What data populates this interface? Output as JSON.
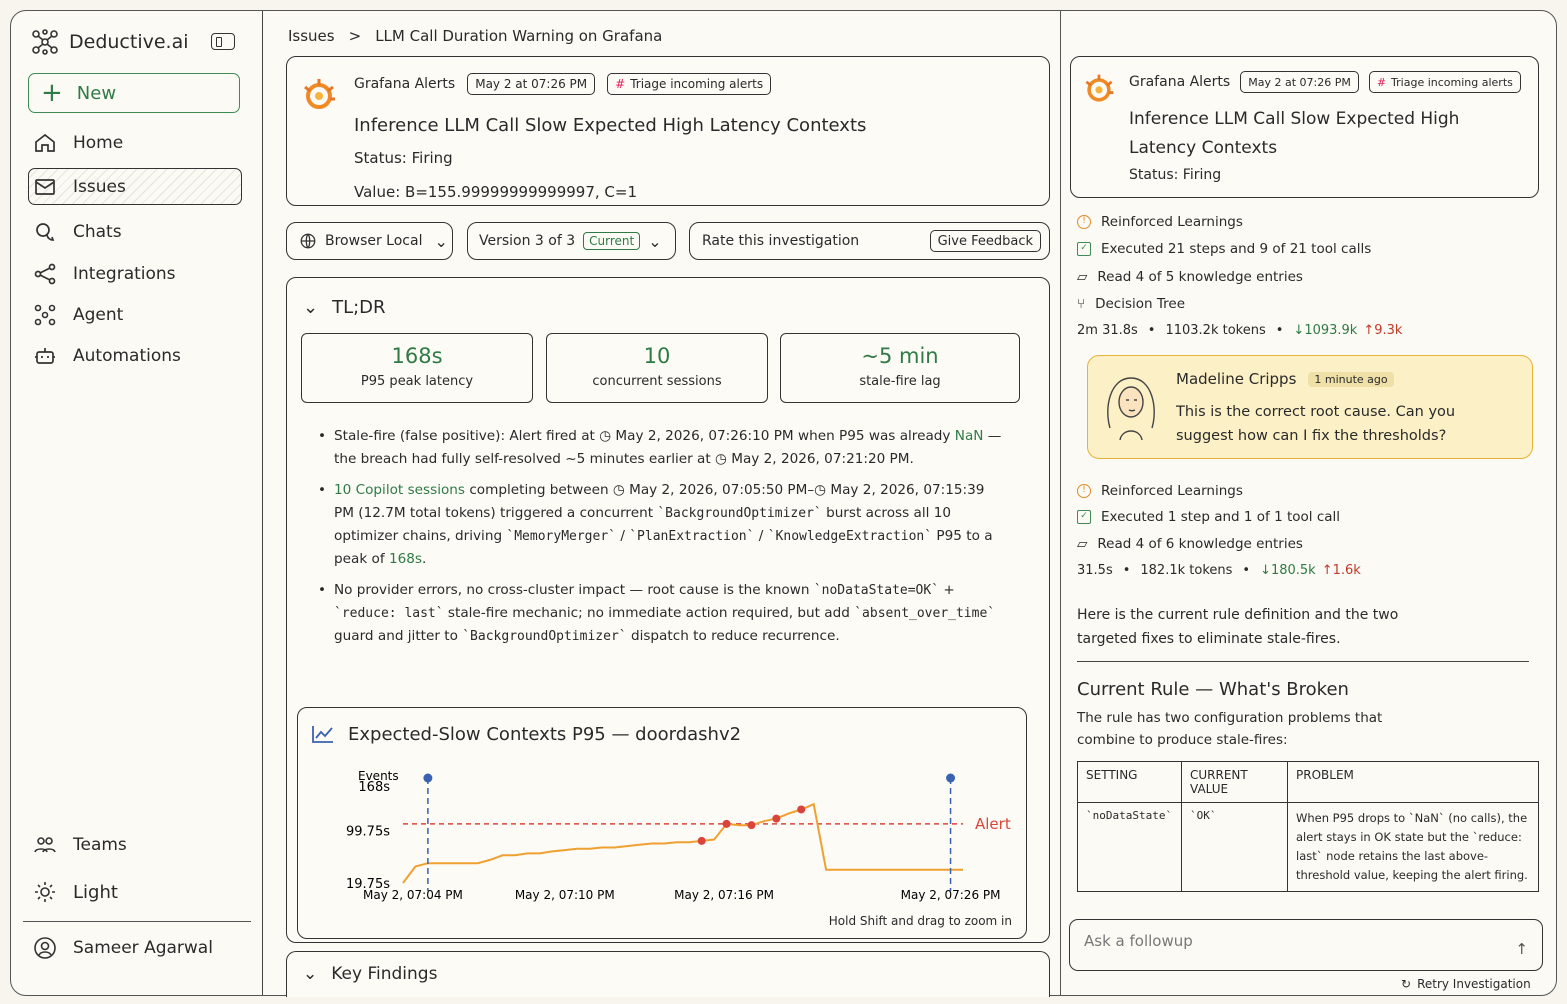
{
  "app": {
    "name": "Deductive.ai"
  },
  "sidebar": {
    "new_label": "New",
    "items": [
      {
        "label": "Home",
        "icon": "home-icon"
      },
      {
        "label": "Issues",
        "icon": "inbox-icon"
      },
      {
        "label": "Chats",
        "icon": "chat-icon"
      },
      {
        "label": "Integrations",
        "icon": "share-icon"
      },
      {
        "label": "Agent",
        "icon": "agent-icon"
      },
      {
        "label": "Automations",
        "icon": "robot-icon"
      }
    ],
    "bottom": {
      "teams": "Teams",
      "theme": "Light",
      "user": "Sameer Agarwal"
    }
  },
  "breadcrumb": {
    "parent": "Issues",
    "sep": ">",
    "current": "LLM Call Duration Warning on Grafana"
  },
  "alert": {
    "source": "Grafana Alerts",
    "date": "May 2 at 07:26 PM",
    "workflow": "Triage incoming alerts",
    "title": "Inference LLM Call Slow Expected High Latency Contexts",
    "status": "Status: Firing",
    "value_label": "Value:",
    "value": "B=155.99999999999997, C=1"
  },
  "toolbar": {
    "env": "Browser Local",
    "version": "Version 3 of 3",
    "version_tag": "Current",
    "rate": "Rate this investigation",
    "feedback": "Give Feedback"
  },
  "tldr": {
    "heading": "TL;DR",
    "stats": [
      {
        "value": "168s",
        "label": "P95 peak latency"
      },
      {
        "value": "10",
        "label": "concurrent sessions"
      },
      {
        "value": "~5 min",
        "label": "stale-fire lag"
      }
    ],
    "b1": {
      "a": "Stale-fire (false positive): Alert fired at",
      "t1": "May 2, 2026, 07:26:10 PM",
      "b": "when P95 was already",
      "nan": "NaN",
      "c": "— the breach had fully self-resolved ~5 minutes earlier at",
      "t2": "May 2, 2026, 07:21:20 PM."
    },
    "b2": {
      "link": "10 Copilot sessions",
      "a": "completing between",
      "t1": "May 2, 2026, 07:05:50 PM–",
      "t2": "May 2, 2026, 07:15:39 PM",
      "b": "(12.7M total tokens) triggered a concurrent",
      "c1": "`BackgroundOptimizer`",
      "c": "burst across all 10 optimizer chains, driving",
      "c2": "`MemoryMerger`",
      "d": "/",
      "c3": "`PlanExtraction`",
      "e": "/",
      "c4": "`KnowledgeExtraction`",
      "f": "P95 to a peak of",
      "peak": "168s",
      "g": "."
    },
    "b3": {
      "a": "No provider errors, no cross-cluster impact — root cause is the known",
      "c1": "`noDataState=OK`",
      "b": "+",
      "c2": "`reduce: last`",
      "c": "stale-fire mechanic; no immediate action required, but add",
      "c3": "`absent_over_time`",
      "d": "guard and jitter to",
      "c4": "`BackgroundOptimizer`",
      "e": "dispatch to reduce recurrence."
    }
  },
  "chart_data": {
    "type": "line",
    "title": "Expected-Slow Contexts P95 — doordashv2",
    "ylabel": "Events",
    "yticks": [
      "168s",
      "99.75s",
      "19.75s"
    ],
    "ylim": [
      19.75,
      180
    ],
    "xticks": [
      "May 2, 07:04 PM",
      "May 2, 07:10 PM",
      "May 2, 07:16 PM",
      "May 2, 07:26 PM"
    ],
    "threshold": {
      "label": "Alert",
      "value": 110
    },
    "hint": "Hold Shift and drag to zoom in",
    "colors": {
      "line": "#f0a030",
      "alert": "#d9453b",
      "marker": "#3b62b0"
    },
    "series": [
      {
        "x": [
          0,
          0.5,
          1,
          1.5,
          2,
          2.5,
          3,
          3.5,
          4,
          4.5,
          5,
          5.5,
          6,
          6.5,
          7,
          7.5,
          8,
          8.5,
          9,
          9.5,
          10,
          10.5,
          11,
          11.5,
          12,
          12.5,
          13,
          13.5,
          14,
          14.5,
          15,
          15.5,
          16,
          16.5,
          17,
          17.5,
          18,
          18.5,
          19,
          19.5,
          20,
          20.5,
          21,
          21.5,
          22,
          22.5
        ],
        "y": [
          19.75,
          45,
          50,
          50,
          50,
          50,
          50,
          55,
          62,
          62,
          65,
          65,
          68,
          70,
          72,
          72,
          74,
          74,
          76,
          78,
          80,
          80,
          82,
          82,
          84,
          86,
          110,
          108,
          108,
          114,
          118,
          126,
          132,
          140,
          40,
          40,
          40,
          40,
          40,
          40,
          40,
          40,
          40,
          40,
          40,
          40
        ]
      }
    ],
    "markers": [
      {
        "x": 1
      },
      {
        "x": 22
      }
    ],
    "dots": [
      12.0,
      13.0,
      14.0,
      15.0,
      16.0
    ]
  },
  "keyfindings": {
    "heading": "Key Findings"
  },
  "right": {
    "source": "Grafana Alerts",
    "date": "May 2 at 07:26 PM",
    "workflow": "Triage incoming alerts",
    "title": "Inference LLM Call Slow Expected High Latency Contexts",
    "status": "Status: Firing",
    "run1": {
      "learn": "Reinforced Learnings",
      "exec": "Executed 21 steps and 9 of 21 tool calls",
      "read": "Read 4 of 5 knowledge entries",
      "tree": "Decision Tree",
      "time": "2m 31.8s",
      "tokens": "1103.2k tokens",
      "down": "↓1093.9k",
      "up": "↑9.3k"
    },
    "comment": {
      "name": "Madeline Cripps",
      "ago": "1 minute ago",
      "text": "This is the correct root cause. Can you suggest how can I fix the thresholds?"
    },
    "run2": {
      "learn": "Reinforced Learnings",
      "exec": "Executed 1 step and 1 of 1 tool call",
      "read": "Read 4 of 6 knowledge entries",
      "time": "31.5s",
      "tokens": "182.1k tokens",
      "down": "↓180.5k",
      "up": "↑1.6k"
    },
    "reply": "Here is the current rule definition and the two targeted fixes to eliminate stale-fires.",
    "rule_heading": "Current Rule — What's Broken",
    "rule_desc": "The rule has two configuration problems that combine to produce stale-fires:",
    "table": {
      "headers": [
        "SETTING",
        "CURRENT VALUE",
        "PROBLEM"
      ],
      "rows": [
        [
          "`noDataState`",
          "`OK`",
          "When P95 drops to `NaN` (no calls), the alert stays in OK state but the `reduce: last` node retains the last above-threshold value, keeping the alert firing."
        ]
      ]
    },
    "ask_placeholder": "Ask a followup",
    "retry": "Retry Investigation"
  }
}
